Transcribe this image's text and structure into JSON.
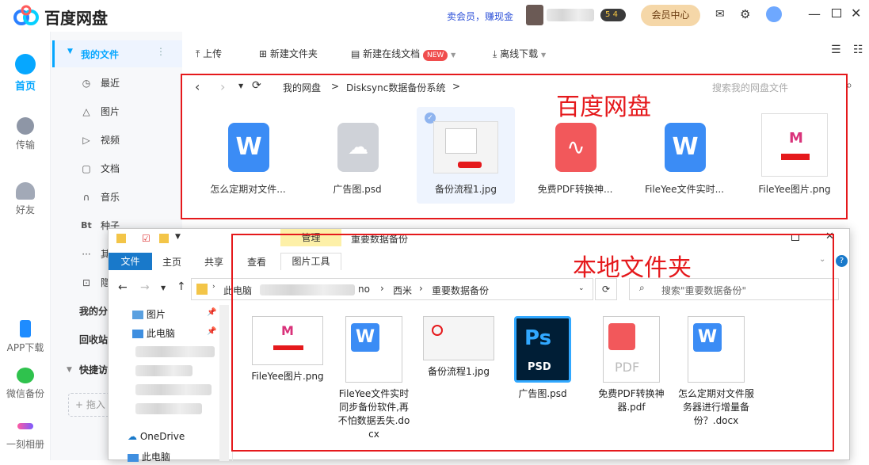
{
  "app": {
    "name": "百度网盘"
  },
  "header": {
    "vip_promo": "卖会员，赚现金",
    "level_badge": "5",
    "level_sub": "4",
    "member_center": "会员中心"
  },
  "rail": {
    "home": "首页",
    "transfer": "传输",
    "friends": "好友",
    "app_download": "APP下载",
    "wechat_backup": "微信备份",
    "moment_album": "一刻相册"
  },
  "nav": {
    "my_files": "我的文件",
    "items": [
      {
        "icon": "clock-icon",
        "label": "最近"
      },
      {
        "icon": "image-icon",
        "label": "图片"
      },
      {
        "icon": "play-icon",
        "label": "视频"
      },
      {
        "icon": "document-icon",
        "label": "文档"
      },
      {
        "icon": "headphones-icon",
        "label": "音乐"
      },
      {
        "icon": "bt-icon",
        "label": "种子"
      },
      {
        "icon": "more-icon",
        "label": "其"
      },
      {
        "icon": "lock-icon",
        "label": "隐"
      }
    ],
    "my_share": "我的分",
    "recycle": "回收站",
    "quick_access": "快捷访",
    "drag_hint": "+ 拖入"
  },
  "toolbar": {
    "upload": "上传",
    "new_folder": "新建文件夹",
    "new_online_doc": "新建在线文档",
    "new_badge": "NEW",
    "offline_download": "离线下载"
  },
  "breadcrumb": {
    "root": "我的网盘",
    "sep": ">",
    "folder": "Disksync数据备份系统",
    "search_placeholder": "搜索我的网盘文件"
  },
  "cloud_files": [
    {
      "name": "怎么定期对文件...",
      "type": "word"
    },
    {
      "name": "广告图.psd",
      "type": "cloud"
    },
    {
      "name": "备份流程1.jpg",
      "type": "image"
    },
    {
      "name": "免费PDF转换神...",
      "type": "pdf"
    },
    {
      "name": "FileYee文件实时...",
      "type": "word"
    },
    {
      "name": "FileYee图片.png",
      "type": "image"
    }
  ],
  "annotations": {
    "cloud": "百度网盘",
    "local": "本地文件夹"
  },
  "explorer": {
    "ribbon_manage": "管理",
    "window_title": "重要数据备份",
    "tabs": [
      "文件",
      "主页",
      "共享",
      "查看",
      "图片工具"
    ],
    "address": {
      "pc": "此电脑",
      "tail": "no",
      "drive": "西米",
      "folder": "重要数据备份"
    },
    "search_placeholder": "搜索\"重要数据备份\"",
    "tree": {
      "pictures": "图片",
      "this_pc": "此电脑",
      "onedrive": "OneDrive",
      "this_pc_2": "此电脑"
    },
    "files": [
      {
        "name": "FileYee图片.png",
        "type": "image"
      },
      {
        "name": "FileYee文件实时同步备份软件,再不怕数据丢失.docx",
        "type": "word"
      },
      {
        "name": "备份流程1.jpg",
        "type": "image"
      },
      {
        "name": "广告图.psd",
        "type": "psd"
      },
      {
        "name": "免费PDF转换神器.pdf",
        "type": "pdf"
      },
      {
        "name": "怎么定期对文件服务器进行增量备份？.docx",
        "type": "word"
      }
    ],
    "psd_badge": "PSD",
    "pdf_badge": "PDF"
  },
  "colors": {
    "brand_blue": "#06a7ff",
    "accent_red": "#e5191c",
    "nav_active": "#06a7ff",
    "explorer_blue": "#1979ca",
    "manage_yellow": "#fdf0a8"
  }
}
